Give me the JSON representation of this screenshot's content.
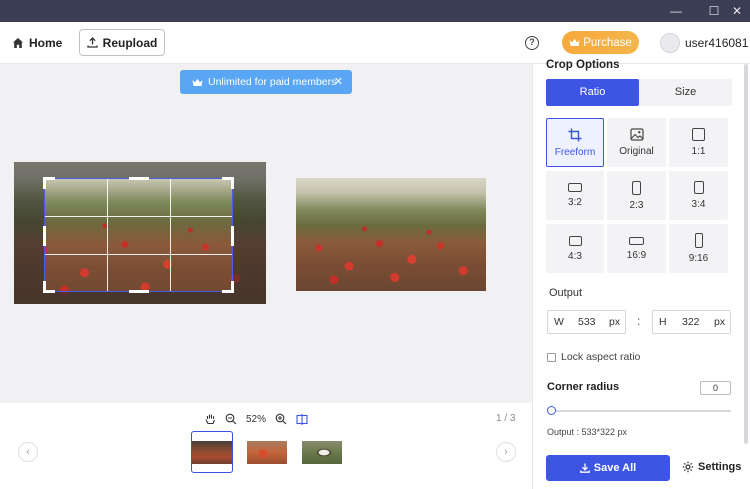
{
  "header": {
    "home_label": "Home",
    "reupload_label": "Reupload",
    "help_glyph": "?",
    "purchase_label": "Purchase",
    "username": "user416081"
  },
  "window_controls": {
    "minimize": "—",
    "maximize": "☐",
    "close": "✕"
  },
  "canvas": {
    "banner_text": "Unlimited for paid members",
    "banner_close": "✕"
  },
  "viewer": {
    "zoom_level": "52%",
    "page_indicator": "1 / 3",
    "prev_glyph": "‹",
    "next_glyph": "›",
    "thumbnails": [
      "thumbnail-1",
      "thumbnail-2",
      "thumbnail-3"
    ],
    "active_thumbnail": 0
  },
  "panel": {
    "title": "Crop Options",
    "tabs": {
      "ratio": "Ratio",
      "size": "Size"
    },
    "ratios": [
      {
        "label": "Freeform",
        "icon": "crop-icon",
        "selected": true
      },
      {
        "label": "Original",
        "icon": "image-icon",
        "selected": false
      },
      {
        "label": "1:1",
        "icon": "square-icon",
        "selected": false
      },
      {
        "label": "3:2",
        "icon": "landscape-rect-icon",
        "selected": false
      },
      {
        "label": "2:3",
        "icon": "portrait-rect-icon",
        "selected": false
      },
      {
        "label": "3:4",
        "icon": "portrait-rect-icon",
        "selected": false
      },
      {
        "label": "4:3",
        "icon": "landscape-rect-icon",
        "selected": false
      },
      {
        "label": "16:9",
        "icon": "wide-rect-icon",
        "selected": false
      },
      {
        "label": "9:16",
        "icon": "tall-rect-icon",
        "selected": false
      }
    ],
    "output_label": "Output",
    "width": {
      "prefix": "W",
      "value": "533",
      "unit": "px"
    },
    "height": {
      "prefix": "H",
      "value": "322",
      "unit": "px"
    },
    "separator": ":",
    "lock_aspect_label": "Lock aspect ratio",
    "corner_radius_label": "Corner radius",
    "corner_radius_value": "0",
    "output_info": "Output :  533*322 px",
    "save_all_label": "Save All",
    "settings_label": "Settings"
  },
  "colors": {
    "accent": "#3d55e4",
    "purchase": "#f4b54b",
    "banner": "#5aa6f4",
    "titlebar": "#3b3d54"
  }
}
